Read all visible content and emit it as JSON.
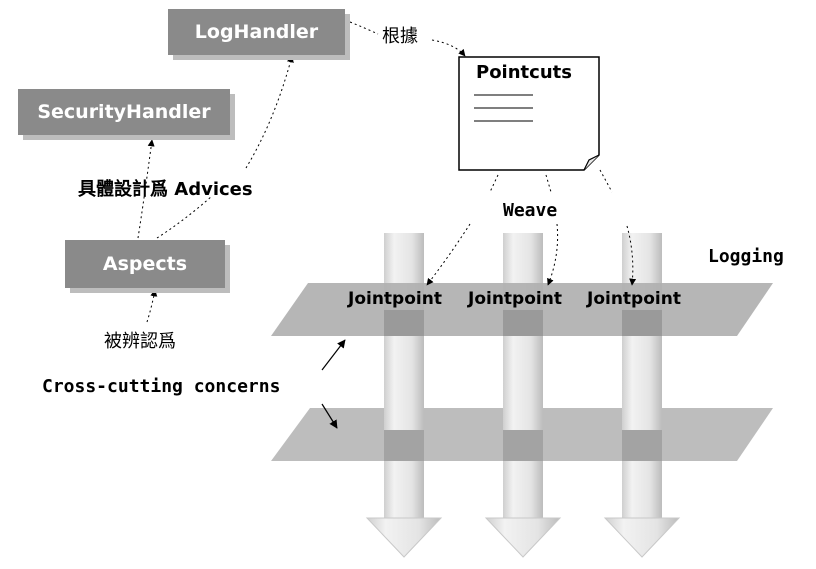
{
  "boxes": {
    "loghandler": "LogHandler",
    "securityhandler": "SecurityHandler",
    "aspects": "Aspects"
  },
  "labels": {
    "based_on": "根據",
    "designed_as": "具體設計爲 Advices",
    "identified_as": "被辨認爲",
    "weave": "Weave",
    "logging": "Logging",
    "crosscutting": "Cross-cutting concerns"
  },
  "document": {
    "title": "Pointcuts"
  },
  "joinpoints": [
    "Jointpoint",
    "Jointpoint",
    "Jointpoint"
  ],
  "colors": {
    "box_fill": "#8a8a8a",
    "box_shadow": "#bdbdbd",
    "plane_fill": "#b4b4b4",
    "column_fill": "#e6e6e6"
  }
}
